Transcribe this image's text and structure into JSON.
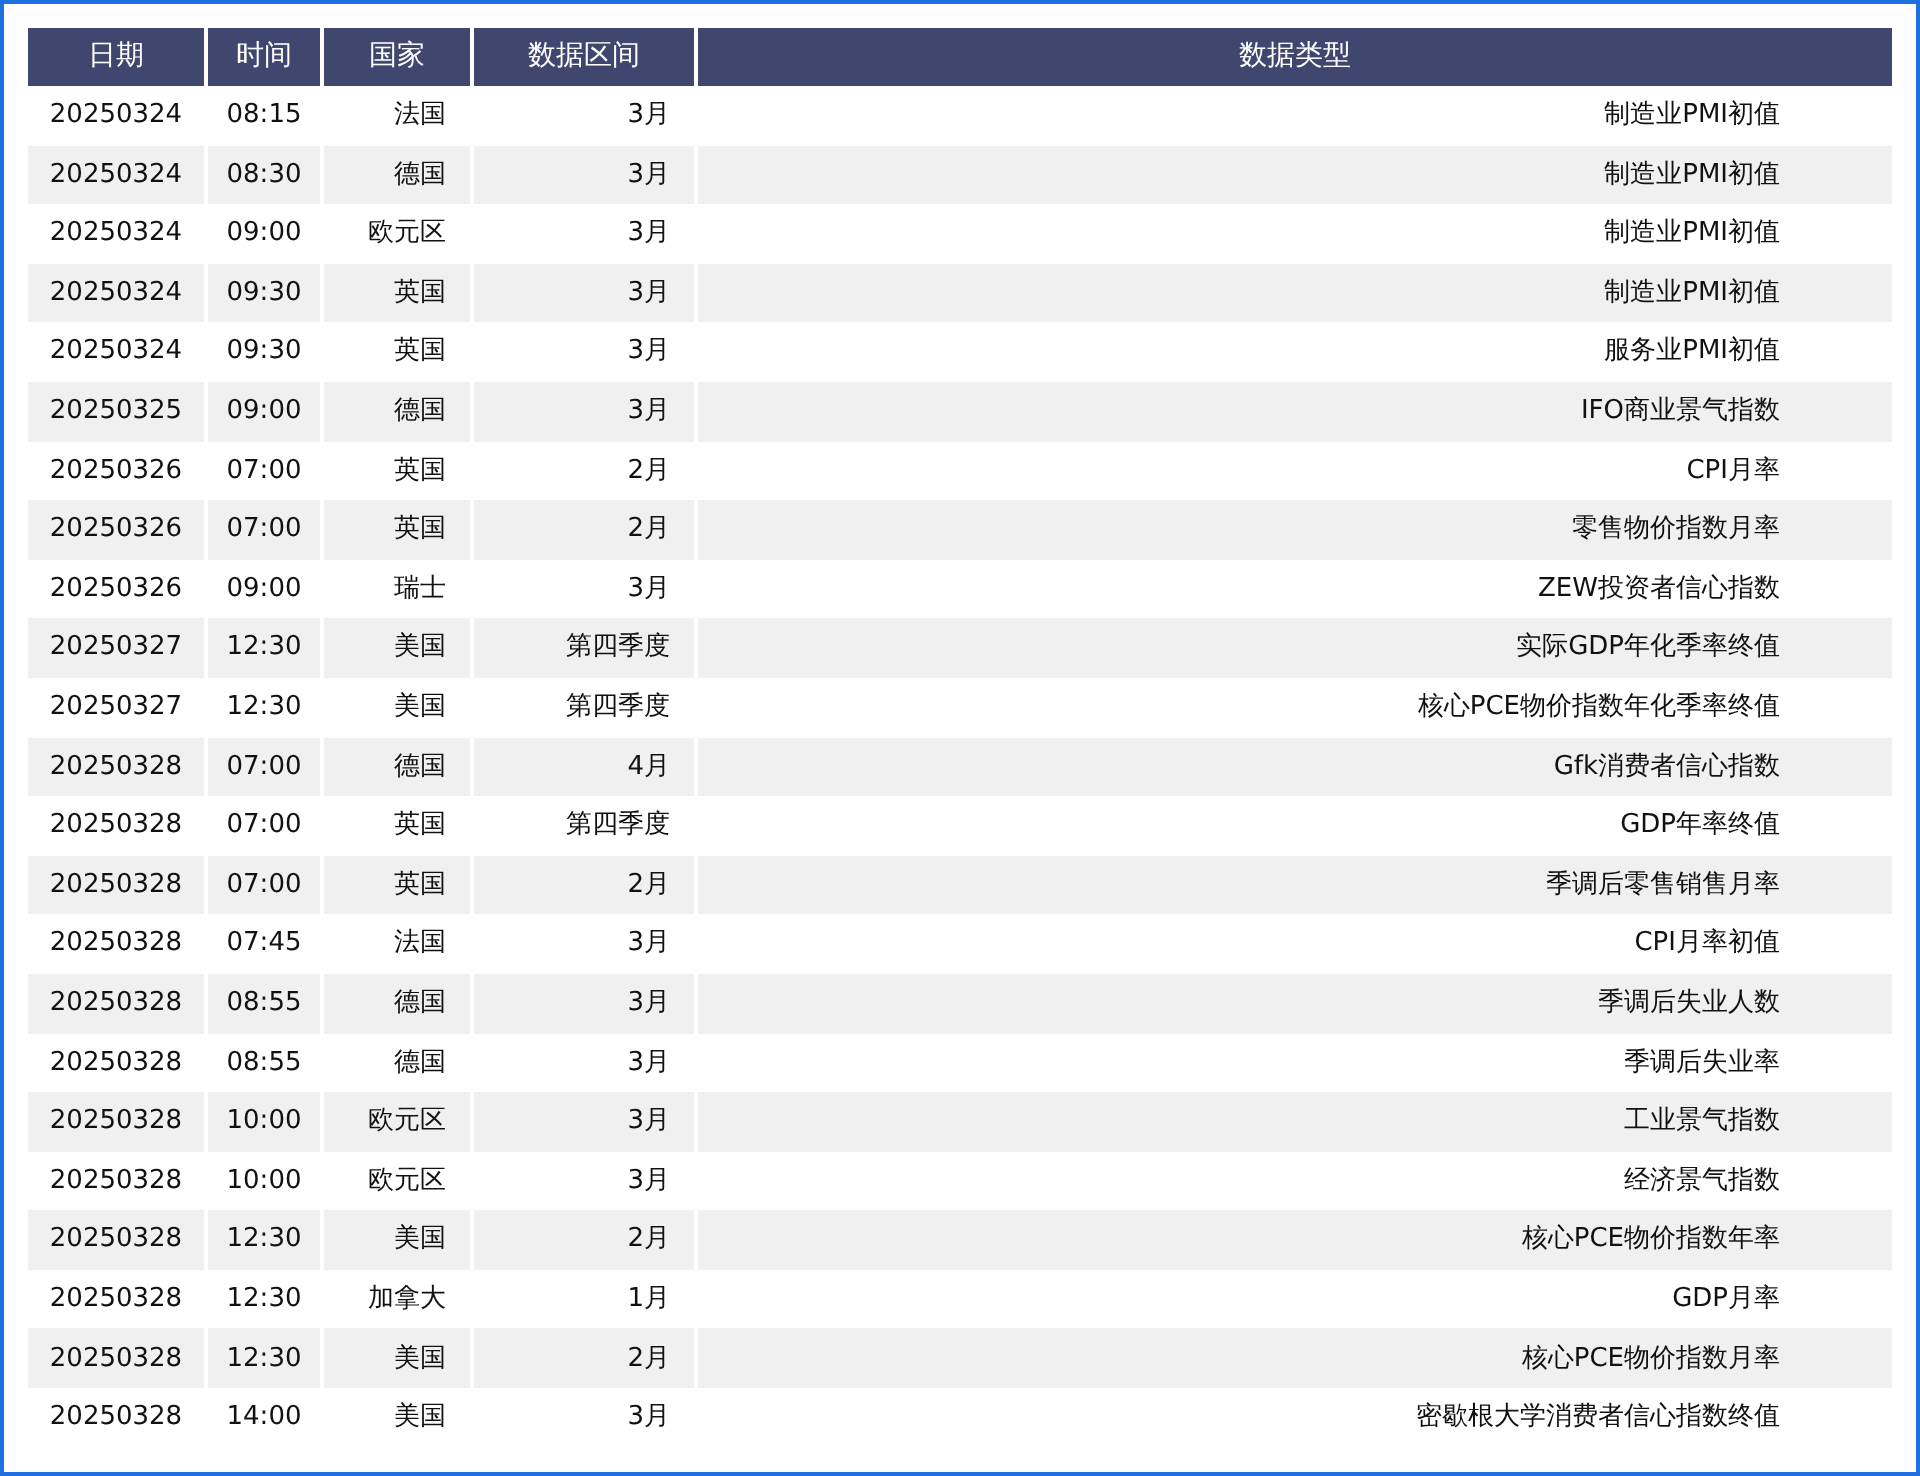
{
  "table": {
    "columns": [
      "日期",
      "时间",
      "国家",
      "数据区间",
      "数据类型"
    ],
    "rows": [
      [
        "20250324",
        "08:15",
        "法国",
        "3月",
        "制造业PMI初值"
      ],
      [
        "20250324",
        "08:30",
        "德国",
        "3月",
        "制造业PMI初值"
      ],
      [
        "20250324",
        "09:00",
        "欧元区",
        "3月",
        "制造业PMI初值"
      ],
      [
        "20250324",
        "09:30",
        "英国",
        "3月",
        "制造业PMI初值"
      ],
      [
        "20250324",
        "09:30",
        "英国",
        "3月",
        "服务业PMI初值"
      ],
      [
        "20250325",
        "09:00",
        "德国",
        "3月",
        "IFO商业景气指数"
      ],
      [
        "20250326",
        "07:00",
        "英国",
        "2月",
        "CPI月率"
      ],
      [
        "20250326",
        "07:00",
        "英国",
        "2月",
        "零售物价指数月率"
      ],
      [
        "20250326",
        "09:00",
        "瑞士",
        "3月",
        "ZEW投资者信心指数"
      ],
      [
        "20250327",
        "12:30",
        "美国",
        "第四季度",
        "实际GDP年化季率终值"
      ],
      [
        "20250327",
        "12:30",
        "美国",
        "第四季度",
        "核心PCE物价指数年化季率终值"
      ],
      [
        "20250328",
        "07:00",
        "德国",
        "4月",
        "Gfk消费者信心指数"
      ],
      [
        "20250328",
        "07:00",
        "英国",
        "第四季度",
        "GDP年率终值"
      ],
      [
        "20250328",
        "07:00",
        "英国",
        "2月",
        "季调后零售销售月率"
      ],
      [
        "20250328",
        "07:45",
        "法国",
        "3月",
        "CPI月率初值"
      ],
      [
        "20250328",
        "08:55",
        "德国",
        "3月",
        "季调后失业人数"
      ],
      [
        "20250328",
        "08:55",
        "德国",
        "3月",
        "季调后失业率"
      ],
      [
        "20250328",
        "10:00",
        "欧元区",
        "3月",
        "工业景气指数"
      ],
      [
        "20250328",
        "10:00",
        "欧元区",
        "3月",
        "经济景气指数"
      ],
      [
        "20250328",
        "12:30",
        "美国",
        "2月",
        "核心PCE物价指数年率"
      ],
      [
        "20250328",
        "12:30",
        "加拿大",
        "1月",
        "GDP月率"
      ],
      [
        "20250328",
        "12:30",
        "美国",
        "2月",
        "核心PCE物价指数月率"
      ],
      [
        "20250328",
        "14:00",
        "美国",
        "3月",
        "密歇根大学消费者信心指数终值"
      ]
    ]
  }
}
